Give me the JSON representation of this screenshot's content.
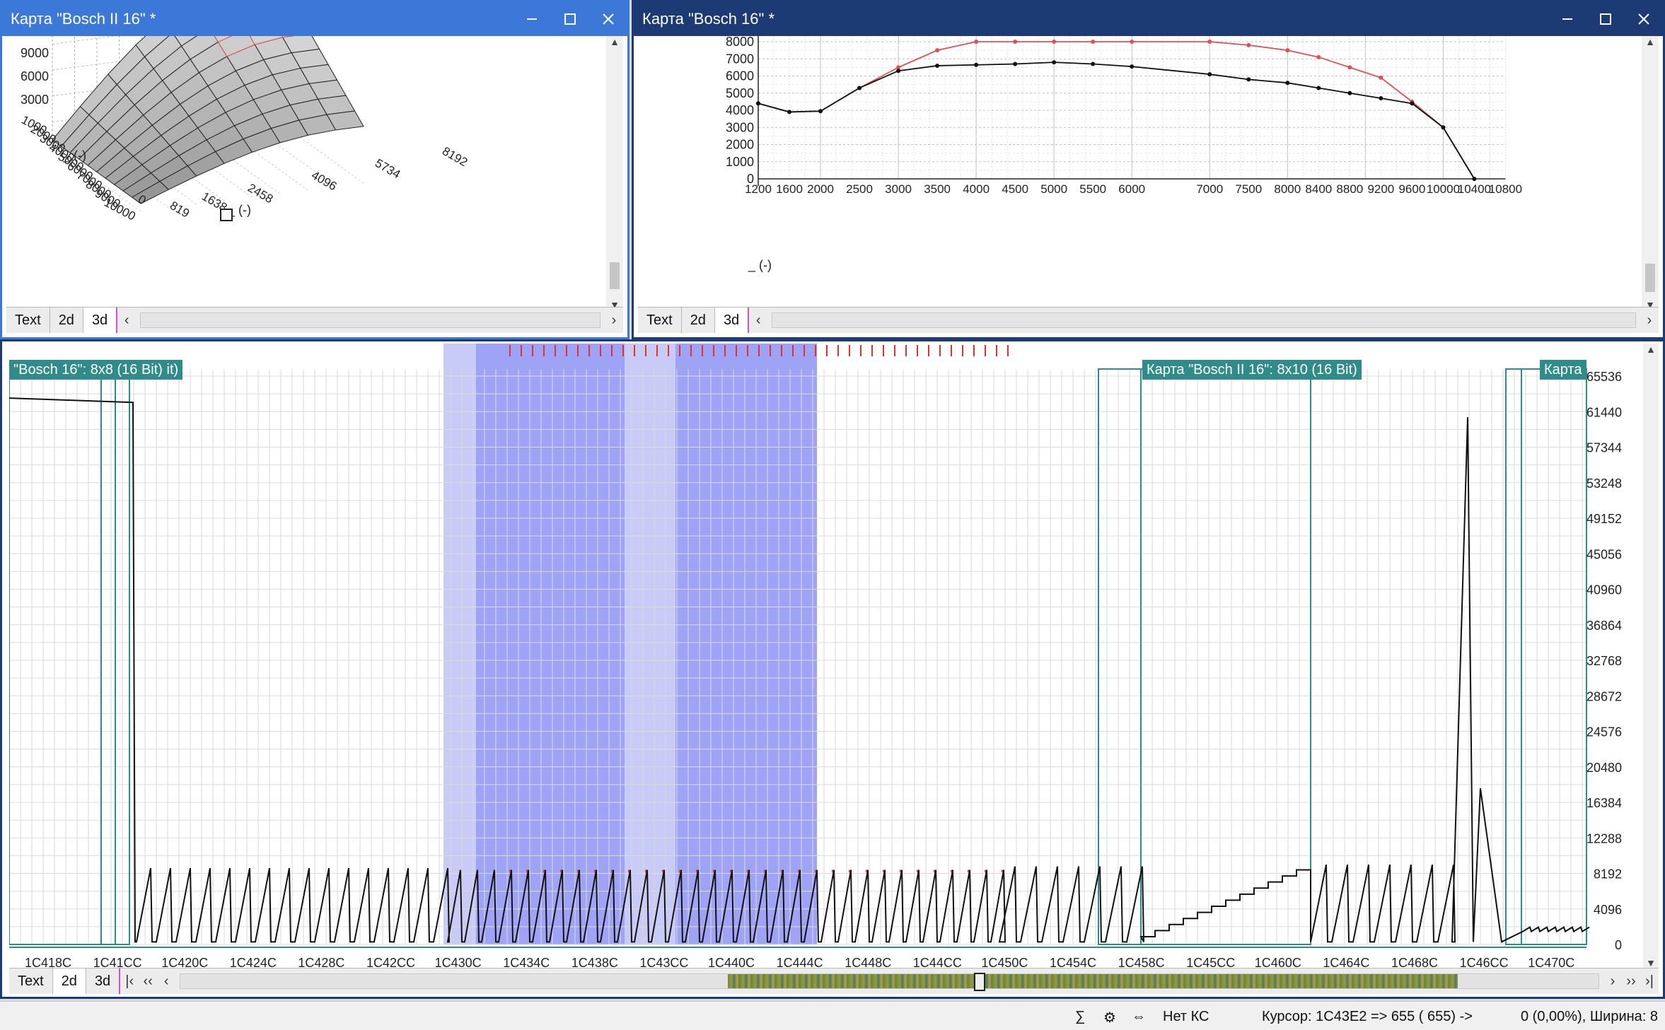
{
  "win3d": {
    "title": "Карта \"Bosch II 16\" *",
    "z_ticks": [
      "9000",
      "6000",
      "3000"
    ],
    "y_ticks": [
      "1000",
      "2000",
      "3000",
      "4000",
      "5000",
      "6000",
      "7000",
      "8000",
      "9000",
      "10000"
    ],
    "x_ticks": [
      "0",
      "819",
      "1638",
      "2458",
      "4096",
      "5734",
      "8192"
    ],
    "x_label": "_ (-)",
    "y_label": "_ (-)",
    "tabs": [
      "Text",
      "2d",
      "3d"
    ],
    "selected_tab": "3d"
  },
  "win2d": {
    "title": "Карта \"Bosch 16\" *",
    "y_label": "_ (-)",
    "tabs": [
      "Text",
      "2d",
      "3d"
    ],
    "selected_tab": "3d",
    "chart_data": {
      "type": "line",
      "x": [
        1200,
        1600,
        2000,
        2500,
        3000,
        3500,
        4000,
        4500,
        5000,
        5500,
        6000,
        7000,
        7500,
        8000,
        8400,
        8800,
        9200,
        9600,
        10000,
        10400
      ],
      "series": [
        {
          "values": [
            4400,
            3900,
            3950,
            5300,
            6300,
            6600,
            6650,
            6700,
            6800,
            6700,
            6550,
            6100,
            5800,
            5600,
            5300,
            5000,
            4700,
            4400,
            3000,
            0
          ]
        },
        {
          "values": [
            4400,
            3900,
            3950,
            5300,
            6500,
            7500,
            8000,
            8000,
            8000,
            8000,
            8000,
            8000,
            7800,
            7500,
            7100,
            6500,
            5900,
            4500,
            3000,
            0
          ]
        }
      ],
      "x_tick_labels": [
        "1200",
        "1600",
        "2000",
        "2500",
        "3000",
        "3500",
        "4000",
        "4500",
        "5000",
        "5500",
        "6000",
        "7000",
        "7500",
        "8000",
        "8400",
        "8800",
        "9200",
        "9600",
        "10000",
        "10400",
        "10800"
      ],
      "y_ticks": [
        "0",
        "1000",
        "2000",
        "3000",
        "4000",
        "5000",
        "6000",
        "7000",
        "8000"
      ],
      "series_colors": [
        "#111111",
        "#e05050"
      ]
    }
  },
  "hexview": {
    "label_left": "\"Bosch 16\": 8x8 (16 Bit) it)",
    "label_mid": "Карта \"Bosch II 16\": 8x10 (16 Bit)",
    "label_right": "Карта",
    "y_ticks": [
      "65536",
      "61440",
      "57344",
      "53248",
      "49152",
      "45056",
      "40960",
      "36864",
      "32768",
      "28672",
      "24576",
      "20480",
      "16384",
      "12288",
      "8192",
      "4096",
      "0"
    ],
    "addresses": [
      "1C418C",
      "1C41CC",
      "1C420C",
      "1C424C",
      "1C428C",
      "1C42CC",
      "1C430C",
      "1C434C",
      "1C438C",
      "1C43CC",
      "1C440C",
      "1C444C",
      "1C448C",
      "1C44CC",
      "1C450C",
      "1C454C",
      "1C458C",
      "1C45CC",
      "1C460C",
      "1C464C",
      "1C468C",
      "1C46CC",
      "1C470C"
    ],
    "tabs": [
      "Text",
      "2d",
      "3d"
    ],
    "selected_tab": "2d",
    "nav": {
      "first": "|‹",
      "prev_page": "‹‹",
      "prev": "‹",
      "next": "›",
      "next_page": "››",
      "last": "›|"
    }
  },
  "status": {
    "crc": "Нет КС",
    "cursor": "Курсор: 1C43E2 =>   655 (  655) ->",
    "selection": "0 (0,00%), Ширина: 8"
  },
  "colors": {
    "active_title": "#1c3a73",
    "inactive_title": "#3b78d8",
    "selection": "#9fa3f5",
    "map_frame": "#2f8c8a"
  }
}
